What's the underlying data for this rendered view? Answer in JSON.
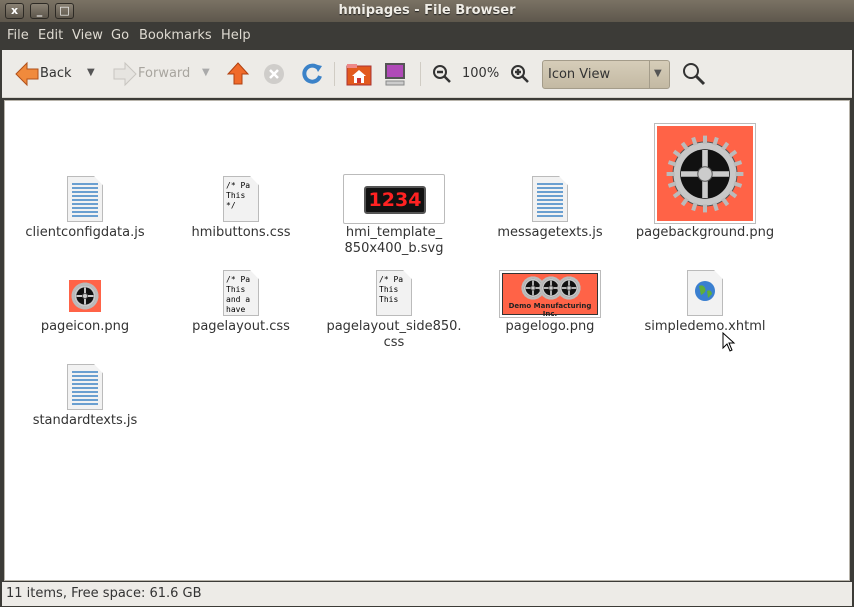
{
  "window": {
    "title": "hmipages - File Browser",
    "close": "x",
    "minimize": "_",
    "maximize": "□"
  },
  "menu": [
    "File",
    "Edit",
    "View",
    "Go",
    "Bookmarks",
    "Help"
  ],
  "toolbar": {
    "back": "Back",
    "forward": "Forward",
    "zoom_level": "100%",
    "view_mode": "Icon View"
  },
  "files": [
    {
      "name": "clientconfigdata.js",
      "type": "js"
    },
    {
      "name": "hmibuttons.css",
      "type": "css",
      "preview": "/* Pa\nThis\n*/"
    },
    {
      "name": "hmi_template_\n850x400_b.svg",
      "type": "svg",
      "preview": "1234"
    },
    {
      "name": "messagetexts.js",
      "type": "js"
    },
    {
      "name": "pagebackground.png",
      "type": "gear-big"
    },
    {
      "name": "pageicon.png",
      "type": "gear-small"
    },
    {
      "name": "pagelayout.css",
      "type": "css",
      "preview": "/* Pa\nThis\nand a\nhave"
    },
    {
      "name": "pagelayout_side850.\ncss",
      "type": "css",
      "preview": "/* Pa\nThis\nThis"
    },
    {
      "name": "pagelogo.png",
      "type": "logo",
      "preview": "Demo Manufacturing Inc."
    },
    {
      "name": "simpledemo.xhtml",
      "type": "html"
    },
    {
      "name": "standardtexts.js",
      "type": "js"
    }
  ],
  "status": "11 items, Free space: 61.6 GB"
}
